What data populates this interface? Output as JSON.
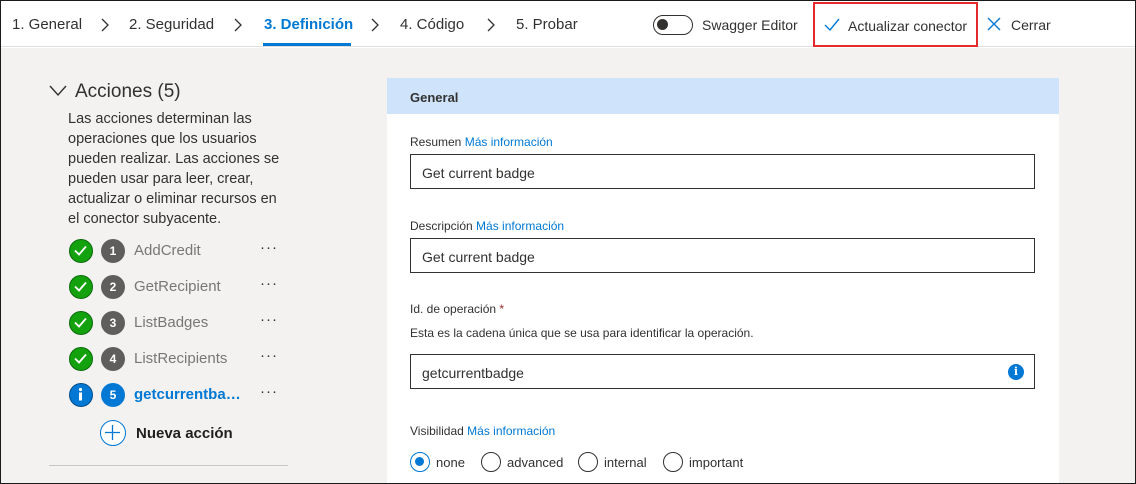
{
  "nav": {
    "steps": [
      {
        "label": "1. General"
      },
      {
        "label": "2. Seguridad"
      },
      {
        "label": "3. Definición"
      },
      {
        "label": "4. Código"
      },
      {
        "label": "5. Probar"
      }
    ],
    "active_step": 2,
    "swagger_label": "Swagger Editor",
    "swagger_on": false,
    "update_label": "Actualizar conector",
    "close_label": "Cerrar"
  },
  "actions": {
    "heading": "Acciones (5)",
    "description": "Las acciones determinan las operaciones que los usuarios pueden realizar. Las acciones se pueden usar para leer, crear, actualizar o eliminar recursos en el conector subyacente.",
    "items": [
      {
        "num": "1",
        "name": "AddCredit",
        "status": "ok"
      },
      {
        "num": "2",
        "name": "GetRecipient",
        "status": "ok"
      },
      {
        "num": "3",
        "name": "ListBadges",
        "status": "ok"
      },
      {
        "num": "4",
        "name": "ListRecipients",
        "status": "ok"
      },
      {
        "num": "5",
        "name": "getcurrentbadge",
        "status": "info",
        "active": true
      }
    ],
    "more_label": "···",
    "new_action_label": "Nueva acción"
  },
  "general": {
    "header": "General",
    "summary_label": "Resumen",
    "summary_link": "Más información",
    "summary_value": "Get current badge",
    "description_label": "Descripción",
    "description_link": "Más información",
    "description_value": "Get current badge",
    "opid_label": "Id. de operación",
    "opid_required": "*",
    "opid_hint": "Esta es la cadena única que se usa para identificar la operación.",
    "opid_value": "getcurrentbadge",
    "visibility_label": "Visibilidad",
    "visibility_link": "Más información",
    "visibility_options": [
      "none",
      "advanced",
      "internal",
      "important"
    ],
    "visibility_selected": "none"
  },
  "colors": {
    "accent": "#0078d4",
    "success": "#13a10e",
    "highlight_border": "#e32b2b",
    "panel_header": "#cfe4fa"
  }
}
